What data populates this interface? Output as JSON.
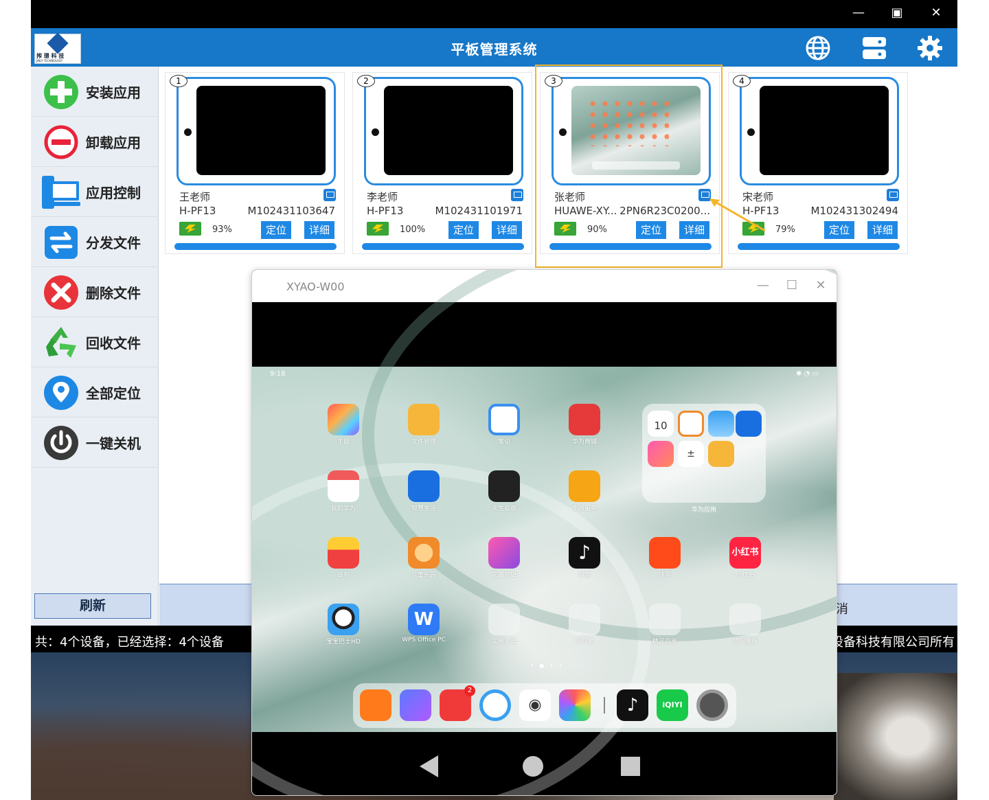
{
  "window_controls": {
    "minimize": "—",
    "maximize": "▣",
    "close": "✕"
  },
  "app": {
    "title": "平板管理系统",
    "logo_text_cn": "搾 璟  科 技",
    "logo_text_en": "JINLY TECHNOLOGY",
    "header_icons": [
      "globe-icon",
      "server-icon",
      "gear-icon"
    ]
  },
  "sidebar": {
    "items": [
      {
        "label": "安装应用",
        "icon": "plus-circle-icon"
      },
      {
        "label": "卸载应用",
        "icon": "minus-circle-icon"
      },
      {
        "label": "应用控制",
        "icon": "computer-control-icon"
      },
      {
        "label": "分发文件",
        "icon": "transfer-arrows-icon"
      },
      {
        "label": "删除文件",
        "icon": "x-circle-icon"
      },
      {
        "label": "回收文件",
        "icon": "recycle-icon"
      },
      {
        "label": "全部定位",
        "icon": "location-pin-icon"
      },
      {
        "label": "一键关机",
        "icon": "power-icon"
      }
    ],
    "refresh_label": "刷新"
  },
  "devices": [
    {
      "index": "1",
      "name": "王老师",
      "model": "H-PF13",
      "serial": "M102431103647",
      "battery": "93%",
      "locate": "定位",
      "detail": "详细",
      "screen_on": false
    },
    {
      "index": "2",
      "name": "李老师",
      "model": "H-PF13",
      "serial": "M102431101971",
      "battery": "100%",
      "locate": "定位",
      "detail": "详细",
      "screen_on": false
    },
    {
      "index": "3",
      "name": "张老师",
      "model": "HUAWE-XY...",
      "serial": "2PN6R23C0200...",
      "battery": "90%",
      "locate": "定位",
      "detail": "详细",
      "screen_on": true
    },
    {
      "index": "4",
      "name": "宋老师",
      "model": "H-PF13",
      "serial": "M102431302494",
      "battery": "79%",
      "locate": "定位",
      "detail": "详细",
      "screen_on": false
    }
  ],
  "bottom_band": {
    "right_label": "消"
  },
  "status": {
    "left": "共：4个设备，已经选择：4个设备",
    "right": "设备科技有限公司所有"
  },
  "popup": {
    "title": "XYAO-W00",
    "controls": {
      "minimize": "—",
      "maximize": "☐",
      "close": "✕"
    },
    "tablet": {
      "time": "9:18",
      "apps": [
        {
          "label": "主题",
          "color": "#ff7a45"
        },
        {
          "label": "文件管理",
          "color": "#f6b63a"
        },
        {
          "label": "笔记",
          "color": "#3a8ff0"
        },
        {
          "label": "华为商城",
          "color": "#e63a3a"
        },
        {
          "label": "我的华为",
          "color": "#f05a5a"
        },
        {
          "label": "智慧生活",
          "color": "#1a6fe0"
        },
        {
          "label": "天生会画",
          "color": "#222222"
        },
        {
          "label": "生活服务",
          "color": "#f6a514"
        },
        {
          "label": "钱包",
          "color": "#f04040"
        },
        {
          "label": "儿童乐园",
          "color": "#f08a2a"
        },
        {
          "label": "花瓣剪辑",
          "color": "#a050d0"
        },
        {
          "label": "抖音",
          "color": "#111111"
        },
        {
          "label": "快手",
          "color": "#ff4a1a"
        },
        {
          "label": "小红书",
          "color": "#ff2442"
        },
        {
          "label": "宝宝巴士HD",
          "color": "#3aa0f0"
        },
        {
          "label": "WPS Office PC",
          "color": "#2f7bf5"
        },
        {
          "label": "实用工具",
          "color": "#e8ece9"
        },
        {
          "label": "手写笔",
          "color": "#e8ece9"
        },
        {
          "label": "精品应用",
          "color": "#e8ece9"
        },
        {
          "label": "热门推荐",
          "color": "#e8ece9"
        }
      ],
      "folder_label": "华为应用",
      "folder_date": "10",
      "xiaohongshu_text": "小红书",
      "iqiyi_text": "iQIYI",
      "dock": [
        "orange-video-icon",
        "music-icon",
        "book-icon",
        "browser-icon",
        "camera-icon",
        "photos-icon",
        "tiktok-icon",
        "iqiyi-icon",
        "settings-icon"
      ],
      "dock_badge": "2"
    }
  }
}
